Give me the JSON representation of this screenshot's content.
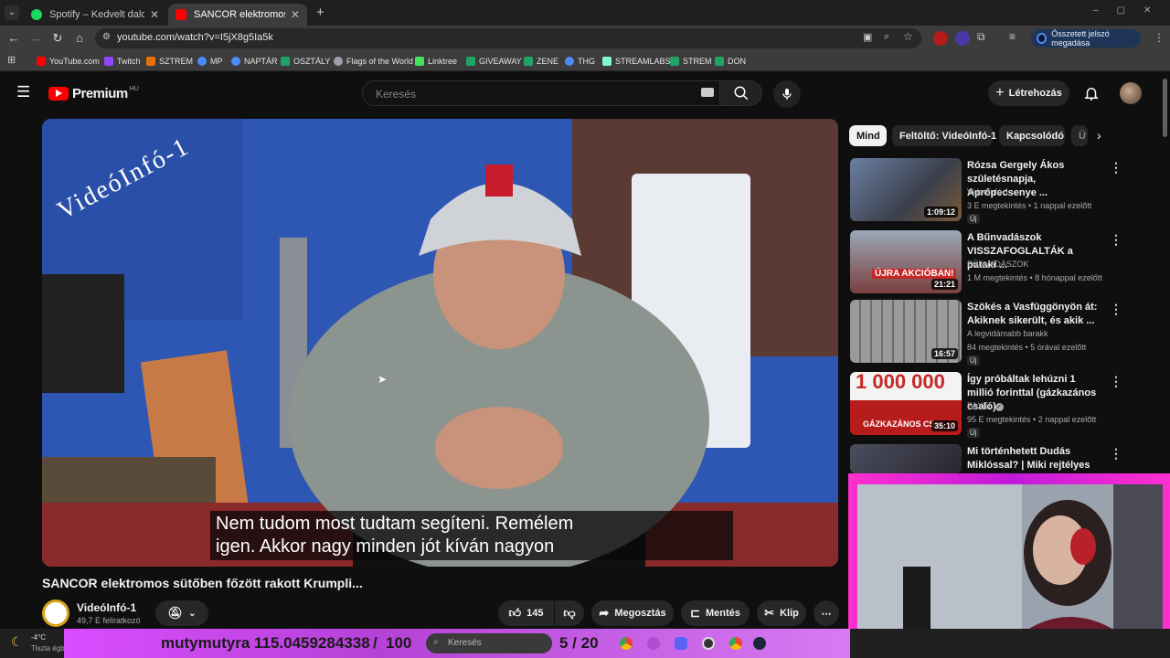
{
  "browser": {
    "tabs": [
      {
        "title": "Spotify – Kedvelt dalok",
        "active": false,
        "favicon_color": "#1ed760"
      },
      {
        "title": "SANCOR elektromos sütőben f...",
        "active": true,
        "favicon_color": "#ff0000"
      }
    ],
    "new_tab_label": "+",
    "url": "youtube.com/watch?v=I5jX8g5Ia5k",
    "password_button": "Összetett jelszó megadása",
    "bookmarks": [
      {
        "label": "YouTube.com",
        "color": "#ff0000"
      },
      {
        "label": "Twitch",
        "color": "#9146ff"
      },
      {
        "label": "SZTREM",
        "color": "#e8710a"
      },
      {
        "label": "MP",
        "color": "#4c8bf5"
      },
      {
        "label": "NAPTÁR",
        "color": "#4c8bf5"
      },
      {
        "label": "OSZTÁLY",
        "color": "#1fa463"
      },
      {
        "label": "Flags of the World",
        "color": "#9aa0a6"
      },
      {
        "label": "Linktree",
        "color": "#43e55e"
      },
      {
        "label": "GIVEAWAY",
        "color": "#1fa463"
      },
      {
        "label": "ZENE",
        "color": "#1fa463"
      },
      {
        "label": "THG",
        "color": "#4c8bf5"
      },
      {
        "label": "STREAMLABS",
        "color": "#80f5d2"
      },
      {
        "label": "STREM",
        "color": "#1fa463"
      },
      {
        "label": "DON",
        "color": "#1fa463"
      }
    ]
  },
  "youtube": {
    "logo_text": "Premium",
    "logo_region": "HU",
    "search_placeholder": "Keresés",
    "create_label": "Létrehozás"
  },
  "video": {
    "watermark": "VideóInfó-1",
    "subtitle_line1": "Nem tudom most tudtam segíteni. Remélem",
    "subtitle_line2": "igen. Akkor nagy minden jót kíván nagyon",
    "title": "SANCOR elektromos sütőben főzött rakott Krumpli...",
    "channel": "VideóInfó-1",
    "subscribers": "49,7 E feliratkozó",
    "likes": "145",
    "share_label": "Megosztás",
    "save_label": "Mentés",
    "clip_label": "Klip"
  },
  "sidebar": {
    "chips": [
      "Mind",
      "Feltöltő: VideóInfó-1",
      "Kapcsolódó",
      "Ü"
    ],
    "recommendations": [
      {
        "title": "Rózsa Gergely Ákos születésnapja, Aprópecsenye ...",
        "channel": "VideóInfó-1",
        "meta": "3 E megtekintés • 1 nappal ezelőtt",
        "badge": "Új",
        "duration": "1:09:12",
        "thumb_color": "#5a6a84"
      },
      {
        "title": "A Bűnvadászok VISSZAFOGLALTÁK a pataki ...",
        "channel": "BŰNVADÁSZOK",
        "meta": "1 M megtekintés • 8 hónappal ezelőtt",
        "badge": "",
        "duration": "21:21",
        "thumb_color": "#8a3a3a",
        "thumb_text": "ÚJRA AKCIÓBAN!"
      },
      {
        "title": "Szökés a Vasfüggönyön át: Akiknek sikerült, és akik ...",
        "channel": "A legvidámabb barakk",
        "meta": "84 megtekintés • 5 órával ezelőtt",
        "badge": "Új",
        "duration": "16:57",
        "thumb_color": "#8a8a8a"
      },
      {
        "title": "Így próbáltak lehúzni 1 millió forinttal (gázkazános csaló)",
        "channel": "PAXEL",
        "meta": "95 E megtekintés • 2 nappal ezelőtt",
        "badge": "Új",
        "duration": "35:10",
        "thumb_color": "#b02020",
        "thumb_text": "1 000 000",
        "thumb_text2": "GÁZKAZÁNOS CS..."
      },
      {
        "title": "Mi történhetett Dudás Miklóssal? | Miki rejtélyes halála",
        "channel": "",
        "meta": "",
        "badge": "",
        "duration": "",
        "thumb_color": "#3a3a4a"
      }
    ]
  },
  "overlay": {
    "username": "mutymutyra",
    "value": "115.0459284338",
    "separator": "/",
    "total": "100",
    "counter": "5 / 20"
  },
  "taskbar": {
    "temperature": "-4°C",
    "weather": "Tiszta égbolt",
    "search_placeholder": "Keresés"
  }
}
